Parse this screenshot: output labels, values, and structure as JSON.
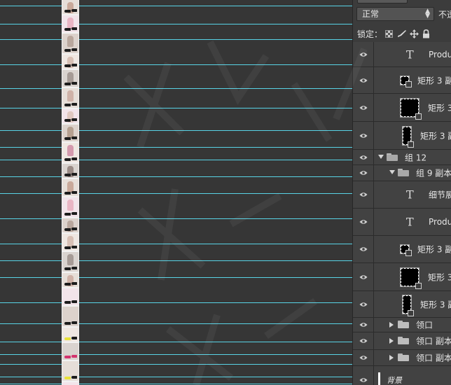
{
  "colors": {
    "canvas_bg": "#363636",
    "guide": "#58d3e6",
    "panel_bg": "#3c3c3c",
    "layer_row": "#424242"
  },
  "canvas": {
    "guides_count": 22
  },
  "layers_panel": {
    "blend_mode": "正常",
    "opacity_label": "不透",
    "lock_label": "锁定：",
    "lock_icons": [
      "lock-transparent-icon",
      "lock-paint-icon",
      "lock-move-icon",
      "lock-all-icon"
    ],
    "layers": [
      {
        "kind": "text",
        "name": "Produc"
      },
      {
        "kind": "shape-small",
        "name": "矩形 3 副"
      },
      {
        "kind": "shape-big",
        "name": "矩形 3"
      },
      {
        "kind": "shape-narrow",
        "name": "矩形 3 副"
      },
      {
        "kind": "group-open",
        "name": "组 12"
      },
      {
        "kind": "group-open-nested",
        "name": "组 9 副本"
      },
      {
        "kind": "text",
        "name": "细节展"
      },
      {
        "kind": "text",
        "name": "Produc"
      },
      {
        "kind": "shape-small",
        "name": "矩形 3 副"
      },
      {
        "kind": "shape-big",
        "name": "矩形 3"
      },
      {
        "kind": "shape-narrow",
        "name": "矩形 3 副"
      },
      {
        "kind": "group-closed",
        "name": "领口"
      },
      {
        "kind": "group-closed",
        "name": "领口 副本"
      },
      {
        "kind": "group-closed",
        "name": "领口 副本"
      },
      {
        "kind": "background",
        "name": "背景"
      }
    ]
  }
}
